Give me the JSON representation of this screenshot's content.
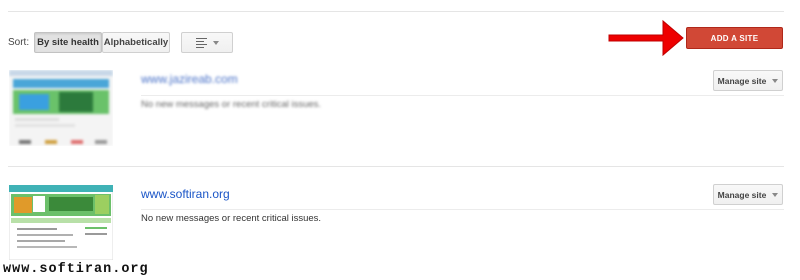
{
  "sort": {
    "label": "Sort:",
    "options": [
      "By site health",
      "Alphabetically"
    ],
    "selected": "By site health"
  },
  "view_toggle": {
    "icon": "list-view-icon"
  },
  "add_site_button": {
    "label": "ADD A SITE",
    "color": "#d14836"
  },
  "annotation": {
    "icon": "red-arrow-icon",
    "color": "#ee0000"
  },
  "sites": [
    {
      "url": "www.jazireab.com",
      "status": "No new messages or recent critical issues.",
      "manage_label": "Manage site",
      "blurred": true
    },
    {
      "url": "www.softiran.org",
      "status": "No new messages or recent critical issues.",
      "manage_label": "Manage site",
      "blurred": false
    }
  ],
  "watermark": "www.softiran.org"
}
